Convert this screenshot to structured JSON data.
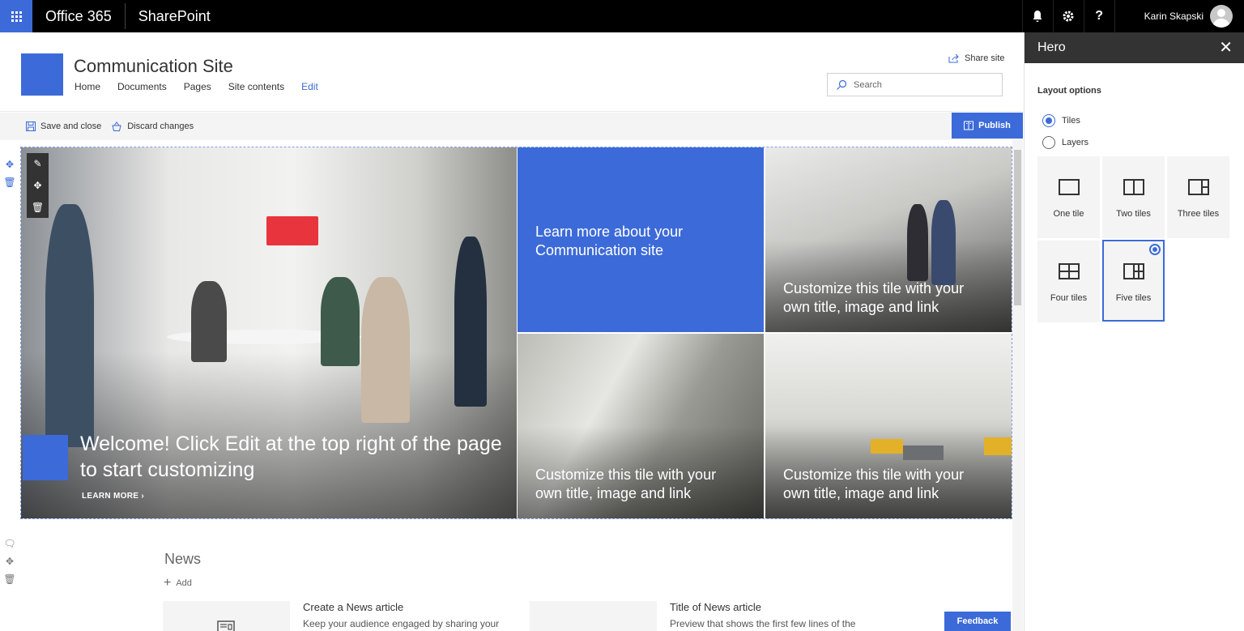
{
  "suitebar": {
    "app_launcher_icon": "waffle-icon",
    "office_label": "Office 365",
    "app_label": "SharePoint",
    "icons": [
      "bell-icon",
      "gear-icon",
      "help-icon"
    ],
    "help_glyph": "?",
    "user_name": "Karin Skapski"
  },
  "site": {
    "title": "Communication Site",
    "nav": [
      "Home",
      "Documents",
      "Pages",
      "Site contents",
      "Edit"
    ],
    "share_label": "Share site",
    "search_placeholder": "Search"
  },
  "commandbar": {
    "save_close": "Save and close",
    "discard": "Discard changes",
    "publish": "Publish"
  },
  "hero": {
    "main": {
      "title": "Welcome! Click Edit at the top right of the page to start customizing",
      "link": "LEARN MORE"
    },
    "tiles": [
      "Learn more about your Communication site",
      "Customize this tile with your own title, image and link",
      "Customize this tile with your own title, image and link",
      "Customize this tile with your own title, image and link"
    ]
  },
  "news": {
    "title": "News",
    "add_label": "Add",
    "items": [
      {
        "title": "Create a News article",
        "body": "Keep your audience engaged by sharing your"
      },
      {
        "title": "Title of News article",
        "body": "Preview that shows the first few lines of the"
      }
    ],
    "feedback": "Feedback"
  },
  "panel": {
    "title": "Hero",
    "layout_label": "Layout options",
    "options": [
      {
        "label": "Tiles",
        "selected": true
      },
      {
        "label": "Layers",
        "selected": false
      }
    ],
    "layouts": [
      {
        "label": "One tile",
        "selected": false
      },
      {
        "label": "Two tiles",
        "selected": false
      },
      {
        "label": "Three tiles",
        "selected": false
      },
      {
        "label": "Four tiles",
        "selected": false
      },
      {
        "label": "Five tiles",
        "selected": true
      }
    ]
  },
  "colors": {
    "accent": "#3c6ad8",
    "suitebar": "#000000",
    "panel_header": "#333333"
  }
}
